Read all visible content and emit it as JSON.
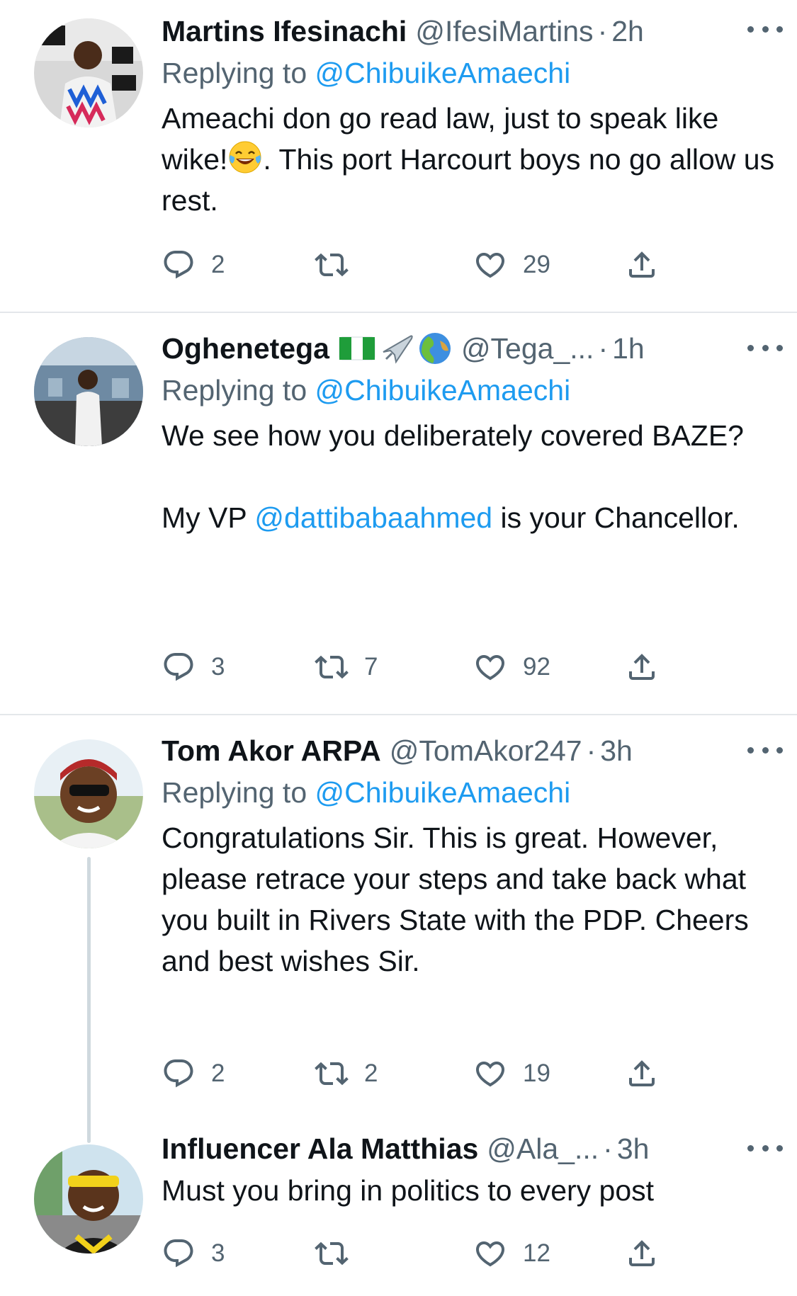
{
  "tweets": [
    {
      "name": "Martins Ifesinachi",
      "handle": "@IfesiMartins",
      "time": "2h",
      "replying_prefix": "Replying to ",
      "replying_to": "@ChibuikeAmaechi",
      "text_part1": "Ameachi don go read law, just to speak like wike!",
      "text_emoji": "laughing-with-tears-emoji",
      "text_part2": ". This port Harcourt boys no go allow us rest.",
      "replies": "2",
      "retweets": "",
      "likes": "29"
    },
    {
      "name": "Oghenetega",
      "flags": [
        "nigeria-flag-emoji",
        "airplane-emoji",
        "globe-emoji"
      ],
      "handle": "@Tega_...",
      "time": "1h",
      "replying_prefix": "Replying to ",
      "replying_to": "@ChibuikeAmaechi",
      "line1": "We see how you deliberately covered BAZE?",
      "line2_prefix": "My VP ",
      "line2_mention": "@dattibabaahmed",
      "line2_suffix": " is your Chancellor.",
      "replies": "3",
      "retweets": "7",
      "likes": "92"
    },
    {
      "name": "Tom Akor ARPA",
      "handle": "@TomAkor247",
      "time": "3h",
      "replying_prefix": "Replying to ",
      "replying_to": "@ChibuikeAmaechi",
      "text": "Congratulations Sir. This is great. However, please retrace your steps and take back what you built in Rivers State with the PDP. Cheers and best wishes Sir.",
      "replies": "2",
      "retweets": "2",
      "likes": "19"
    },
    {
      "name": "Influencer Ala Matthias",
      "handle": "@Ala_...",
      "time": "3h",
      "text": "Must you bring in politics to every post",
      "replies": "3",
      "retweets": "",
      "likes": "12"
    }
  ],
  "separator": "·",
  "colors": {
    "text": "#0f1419",
    "secondary": "#536471",
    "link": "#1d9bf0",
    "divider": "#e4e7ea",
    "thread_line": "#cfd9de"
  },
  "icons": [
    "reply-icon",
    "retweet-icon",
    "like-icon",
    "share-icon",
    "more-icon"
  ]
}
